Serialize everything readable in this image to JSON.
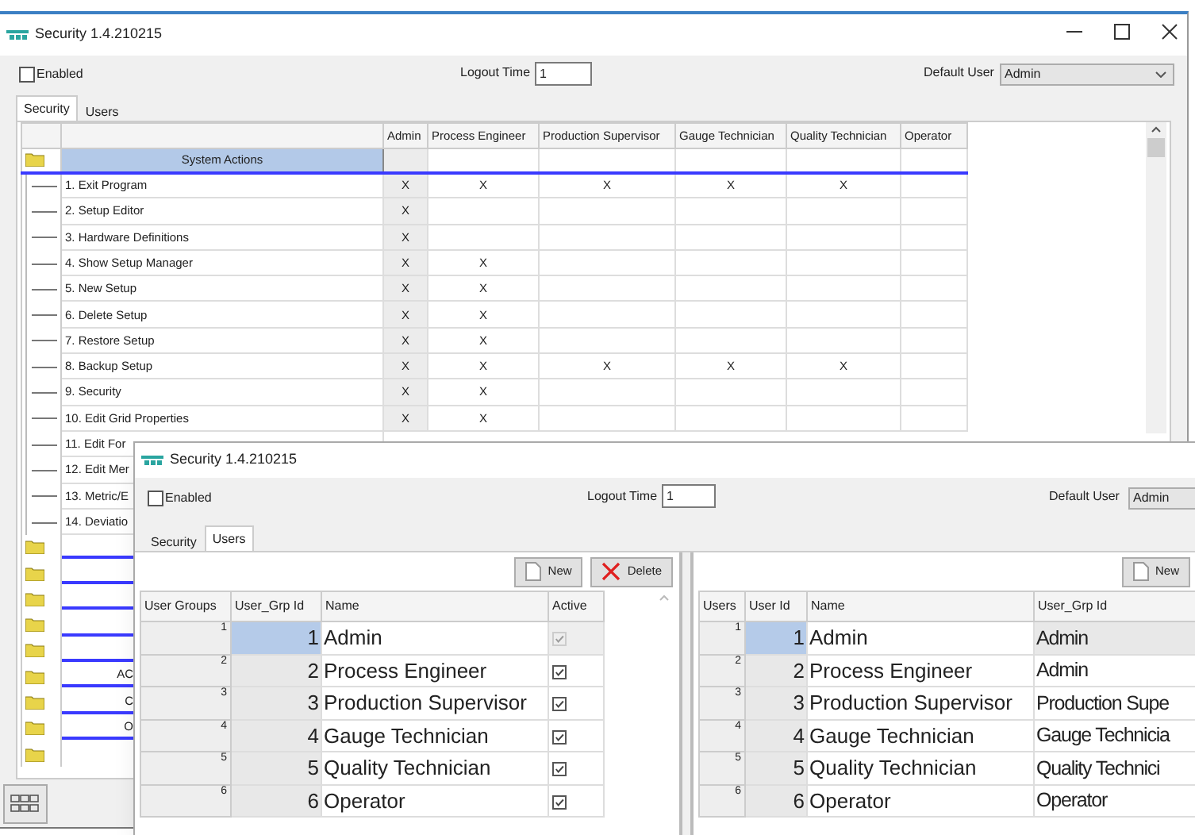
{
  "back_window": {
    "title": "Security 1.4.210215",
    "enabled": {
      "label": "Enabled",
      "checked": false
    },
    "logout_time": {
      "label": "Logout Time",
      "value": "1"
    },
    "default_user": {
      "label": "Default User",
      "value": "Admin"
    },
    "tabs": [
      {
        "label": "Security",
        "selected": true
      },
      {
        "label": "Users",
        "selected": false
      }
    ],
    "permissions_grid": {
      "columns": [
        "Admin",
        "Process Engineer",
        "Production Supervisor",
        "Gauge Technician",
        "Quality Technician",
        "Operator"
      ],
      "section": "System Actions",
      "rows": [
        {
          "label": "1. Exit Program",
          "cells": [
            "X",
            "X",
            "X",
            "X",
            "X",
            null
          ]
        },
        {
          "label": "2. Setup Editor",
          "cells": [
            "X",
            null,
            null,
            null,
            null,
            null
          ]
        },
        {
          "label": "3. Hardware Definitions",
          "cells": [
            "X",
            null,
            null,
            null,
            null,
            null
          ]
        },
        {
          "label": "4. Show Setup Manager",
          "cells": [
            "X",
            "X",
            null,
            null,
            null,
            null
          ]
        },
        {
          "label": "5. New Setup",
          "cells": [
            "X",
            "X",
            null,
            null,
            null,
            null
          ]
        },
        {
          "label": "6. Delete Setup",
          "cells": [
            "X",
            "X",
            null,
            null,
            null,
            null
          ]
        },
        {
          "label": "7. Restore Setup",
          "cells": [
            "X",
            "X",
            null,
            null,
            null,
            null
          ]
        },
        {
          "label": "8. Backup Setup",
          "cells": [
            "X",
            "X",
            "X",
            "X",
            "X",
            null
          ]
        },
        {
          "label": "9. Security",
          "cells": [
            "X",
            "X",
            null,
            null,
            null,
            null
          ]
        },
        {
          "label": "10. Edit Grid Properties",
          "cells": [
            "X",
            "X",
            null,
            null,
            null,
            null
          ]
        },
        {
          "label": "11. Edit For"
        },
        {
          "label": "12. Edit Mer"
        },
        {
          "label": "13. Metric/E"
        },
        {
          "label": "14. Deviatio"
        }
      ],
      "folder_rows": [
        null,
        null,
        null,
        null,
        null,
        "AC",
        "C",
        "O",
        null
      ]
    }
  },
  "front_window": {
    "title": "Security 1.4.210215",
    "enabled": {
      "label": "Enabled",
      "checked": false
    },
    "logout_time": {
      "label": "Logout Time",
      "value": "1"
    },
    "default_user": {
      "label": "Default User",
      "value": "Admin"
    },
    "tabs": [
      {
        "label": "Security",
        "selected": false
      },
      {
        "label": "Users",
        "selected": true
      }
    ],
    "groups_panel": {
      "buttons": [
        {
          "label": "New",
          "kind": "new"
        },
        {
          "label": "Delete",
          "kind": "delete"
        }
      ],
      "columns": [
        "User Groups",
        "User_Grp Id",
        "Name",
        "Active"
      ],
      "rows": [
        {
          "row": "1",
          "id": "1",
          "name": "Admin",
          "active": true,
          "disabled": true,
          "selected": true
        },
        {
          "row": "2",
          "id": "2",
          "name": "Process Engineer",
          "active": true,
          "disabled": false,
          "selected": false
        },
        {
          "row": "3",
          "id": "3",
          "name": "Production Supervisor",
          "active": true,
          "disabled": false,
          "selected": false
        },
        {
          "row": "4",
          "id": "4",
          "name": "Gauge Technician",
          "active": true,
          "disabled": false,
          "selected": false
        },
        {
          "row": "5",
          "id": "5",
          "name": "Quality Technician",
          "active": true,
          "disabled": false,
          "selected": false
        },
        {
          "row": "6",
          "id": "6",
          "name": "Operator",
          "active": true,
          "disabled": false,
          "selected": false
        }
      ]
    },
    "users_panel": {
      "buttons": [
        {
          "label": "New",
          "kind": "new"
        }
      ],
      "columns": [
        "Users",
        "User Id",
        "Name",
        "User_Grp Id"
      ],
      "rows": [
        {
          "row": "1",
          "id": "1",
          "name": "Admin",
          "group": "Admin",
          "selected": true
        },
        {
          "row": "2",
          "id": "2",
          "name": "Process Engineer",
          "group": "Admin",
          "selected": false
        },
        {
          "row": "3",
          "id": "3",
          "name": "Production Supervisor",
          "group": "Production Supe",
          "selected": false
        },
        {
          "row": "4",
          "id": "4",
          "name": "Gauge Technician",
          "group": "Gauge Technicia",
          "selected": false
        },
        {
          "row": "5",
          "id": "5",
          "name": "Quality Technician",
          "group": "Quality Technici",
          "selected": false
        },
        {
          "row": "6",
          "id": "6",
          "name": "Operator",
          "group": "Operator",
          "selected": false
        }
      ]
    }
  }
}
